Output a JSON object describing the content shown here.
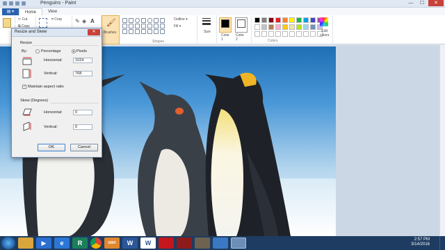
{
  "window": {
    "title": "Penguins - Paint",
    "minimize": "—",
    "maximize": "☐",
    "close": "✕"
  },
  "ribbon": {
    "file_tab": "▤ ▾",
    "tabs": [
      "Home",
      "View"
    ],
    "clipboard": {
      "cut": "Cut",
      "copy": "Copy"
    },
    "image_group": {
      "crop": "Crop"
    },
    "brushes": "Brushes",
    "shapes": {
      "label": "Shapes",
      "outline": "Outline ▾",
      "fill": "Fill ▾"
    },
    "size": "Size",
    "color1": {
      "label": "Color",
      "sub": "1"
    },
    "color2": {
      "label": "Color",
      "sub": "2"
    },
    "colors_label": "Colors",
    "edit_colors": {
      "line1": "Edit",
      "line2": "colors"
    },
    "palette": [
      "#000000",
      "#7f7f7f",
      "#880015",
      "#ed1c24",
      "#ff7f27",
      "#fff200",
      "#22b14c",
      "#00a2e8",
      "#3f48cc",
      "#a349a4",
      "#ffffff",
      "#c3c3c3",
      "#b97a57",
      "#ffaec9",
      "#ffc90e",
      "#efe4b0",
      "#b5e61d",
      "#99d9ea",
      "#7092be",
      "#c8bfe7",
      "#ffffff",
      "#ffffff",
      "#ffffff",
      "#ffffff",
      "#ffffff",
      "#ffffff",
      "#ffffff",
      "#ffffff",
      "#ffffff",
      "#ffffff"
    ],
    "color1_value": "#000000",
    "color2_value": "#ffffff"
  },
  "dialog": {
    "title": "Resize and Skew",
    "close": "✕",
    "resize_heading": "Resize",
    "by_label": "By:",
    "percentage_label": "Percentage",
    "pixels_label": "Pixels",
    "selected_mode": "Pixels",
    "horizontal_label": "Horizontal:",
    "horizontal_value": "1024",
    "vertical_label": "Vertical:",
    "vertical_value": "768",
    "maintain_label": "Maintain aspect ratio",
    "maintain_checked": true,
    "skew_heading": "Skew (Degrees)",
    "skew_horizontal_label": "Horizontal:",
    "skew_horizontal_value": "0",
    "skew_vertical_label": "Vertical:",
    "skew_vertical_value": "0",
    "ok_label": "OK",
    "cancel_label": "Cancel"
  },
  "taskbar": {
    "time": "2:57 PM",
    "date": "3/14/2016",
    "items": [
      "explorer-icon",
      "media-player-icon",
      "ie-icon",
      "app-r-icon",
      "chrome-icon",
      "gmx-icon",
      "word-icon",
      "word-doc-icon",
      "acrobat-icon",
      "acrobat2-icon",
      "gimp-icon",
      "speedometer-icon",
      "paint-icon"
    ],
    "item_labels": [
      "",
      "",
      "e",
      "R",
      "",
      "GMX",
      "W",
      "W",
      "",
      "",
      "",
      "",
      ""
    ]
  }
}
